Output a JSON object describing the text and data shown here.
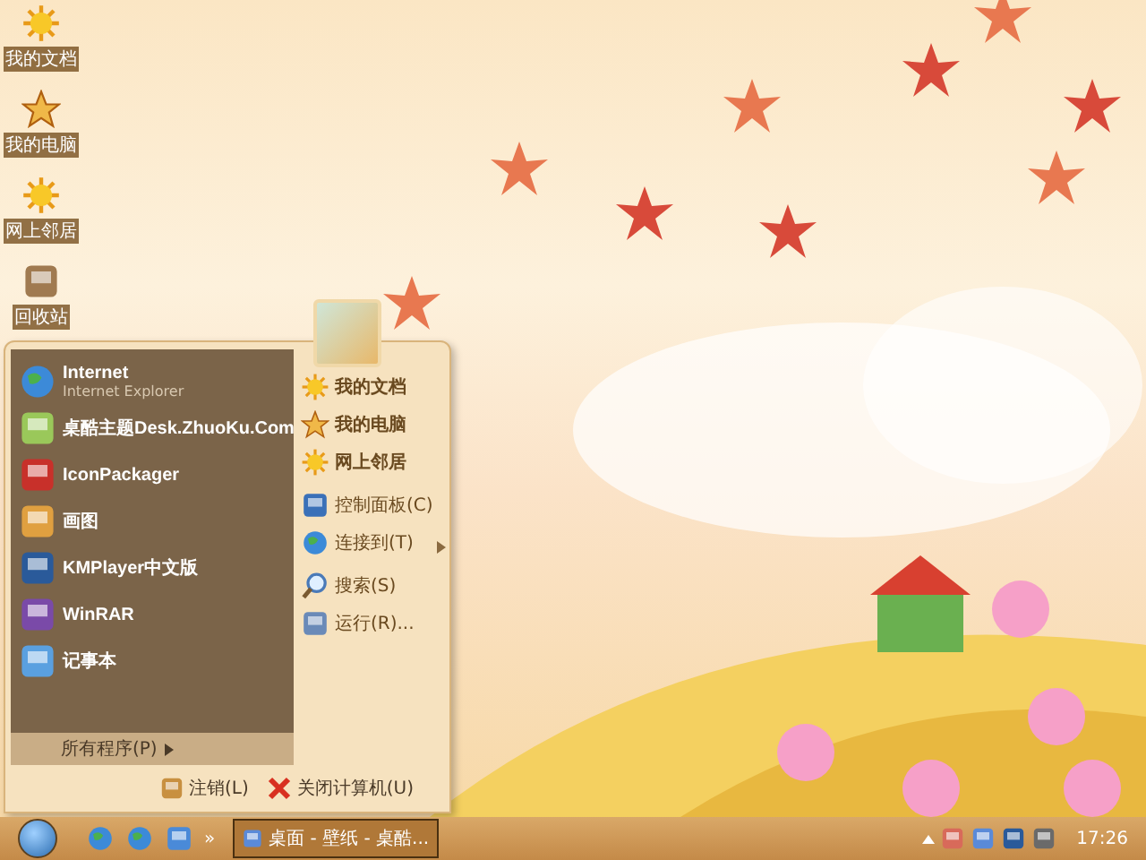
{
  "desktop_icons": [
    {
      "label": "我的文档"
    },
    {
      "label": "我的电脑"
    },
    {
      "label": "网上邻居"
    },
    {
      "label": "回收站"
    }
  ],
  "start_menu": {
    "programs": [
      {
        "label": "Internet",
        "sublabel": "Internet Explorer"
      },
      {
        "label": "桌酷主题Desk.ZhuoKu.Com"
      },
      {
        "label": "IconPackager"
      },
      {
        "label": "画图"
      },
      {
        "label": "KMPlayer中文版"
      },
      {
        "label": "WinRAR"
      },
      {
        "label": "记事本"
      }
    ],
    "all_programs": "所有程序(P)",
    "places": [
      [
        {
          "label": "我的文档",
          "submenu": false
        },
        {
          "label": "我的电脑",
          "submenu": false
        },
        {
          "label": "网上邻居",
          "submenu": false
        }
      ],
      [
        {
          "label": "控制面板(C)",
          "submenu": false
        },
        {
          "label": "连接到(T)",
          "submenu": true
        }
      ],
      [
        {
          "label": "搜索(S)",
          "submenu": false
        },
        {
          "label": "运行(R)...",
          "submenu": false
        }
      ]
    ],
    "log_off": "注销(L)",
    "shut_down": "关闭计算机(U)"
  },
  "taskbar": {
    "quick_launch_more": "»",
    "tasks": [
      {
        "label": "桌面 - 壁纸 - 桌酷...",
        "selected": true
      }
    ],
    "clock": "17:26"
  }
}
